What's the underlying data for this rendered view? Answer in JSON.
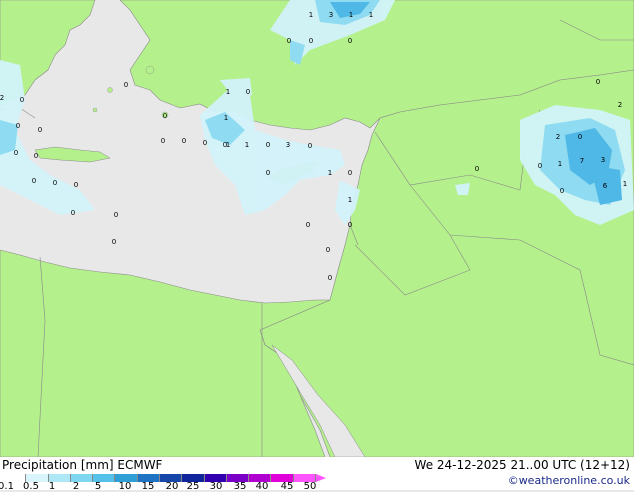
{
  "header": {
    "title_left": "Precipitation [mm]  ECMWF",
    "title_right": "We 24-12-2025 21..00 UTC (12+12)",
    "credit": "©weatheronline.co.uk"
  },
  "legend": {
    "ticks": [
      "0.1",
      "0.5",
      "1",
      "2",
      "5",
      "10",
      "15",
      "20",
      "25",
      "30",
      "35",
      "40",
      "45",
      "50"
    ],
    "colors": [
      "#ffffff",
      "#d8f5fb",
      "#aee8f6",
      "#7fd6f0",
      "#55c0e8",
      "#2f9fd8",
      "#1f73c4",
      "#1546a8",
      "#10259a",
      "#3000b0",
      "#7a00c8",
      "#b000d0",
      "#e000d8",
      "#ff55ff"
    ]
  },
  "map": {
    "land_color": "#b4f08c",
    "sea_color": "#e8e8e8",
    "border_color": "#8a8a8a",
    "precip_values": [
      {
        "id": "a",
        "text": "1"
      },
      {
        "id": "b",
        "text": "3"
      },
      {
        "id": "c",
        "text": "1"
      },
      {
        "id": "d",
        "text": "1"
      },
      {
        "id": "e",
        "text": "0"
      },
      {
        "id": "f",
        "text": "0"
      },
      {
        "id": "g",
        "text": "0"
      },
      {
        "id": "h",
        "text": "2"
      },
      {
        "id": "i",
        "text": "0"
      },
      {
        "id": "j",
        "text": "0"
      },
      {
        "id": "k",
        "text": "1"
      },
      {
        "id": "l",
        "text": "0"
      },
      {
        "id": "m",
        "text": "0"
      },
      {
        "id": "n",
        "text": "0"
      },
      {
        "id": "o",
        "text": "0"
      },
      {
        "id": "p",
        "text": "0"
      },
      {
        "id": "q",
        "text": "0"
      },
      {
        "id": "r",
        "text": "0"
      },
      {
        "id": "s",
        "text": "1"
      },
      {
        "id": "t",
        "text": "0"
      },
      {
        "id": "u",
        "text": "0"
      },
      {
        "id": "v",
        "text": "0"
      },
      {
        "id": "w",
        "text": "1"
      },
      {
        "id": "x",
        "text": "1"
      },
      {
        "id": "y",
        "text": "0"
      },
      {
        "id": "z",
        "text": "3"
      },
      {
        "id": "aa",
        "text": "0"
      },
      {
        "id": "ab",
        "text": "0"
      },
      {
        "id": "ac",
        "text": "1"
      },
      {
        "id": "ad",
        "text": "0"
      },
      {
        "id": "ae",
        "text": "1"
      },
      {
        "id": "af",
        "text": "0"
      },
      {
        "id": "ag",
        "text": "0"
      },
      {
        "id": "ah",
        "text": "0"
      },
      {
        "id": "ai",
        "text": "0"
      },
      {
        "id": "aj",
        "text": "0"
      },
      {
        "id": "ak",
        "text": "0"
      },
      {
        "id": "al",
        "text": "0"
      },
      {
        "id": "am",
        "text": "0"
      },
      {
        "id": "an",
        "text": "0"
      },
      {
        "id": "ao",
        "text": "2"
      },
      {
        "id": "ap",
        "text": "0"
      },
      {
        "id": "aq",
        "text": "2"
      },
      {
        "id": "ar",
        "text": "0"
      },
      {
        "id": "as",
        "text": "1"
      },
      {
        "id": "at",
        "text": "7"
      },
      {
        "id": "au",
        "text": "3"
      },
      {
        "id": "av",
        "text": "0"
      },
      {
        "id": "aw",
        "text": "0"
      },
      {
        "id": "ax",
        "text": "6"
      },
      {
        "id": "ay",
        "text": "1"
      },
      {
        "id": "az",
        "text": "0"
      },
      {
        "id": "ba",
        "text": "0"
      }
    ]
  }
}
